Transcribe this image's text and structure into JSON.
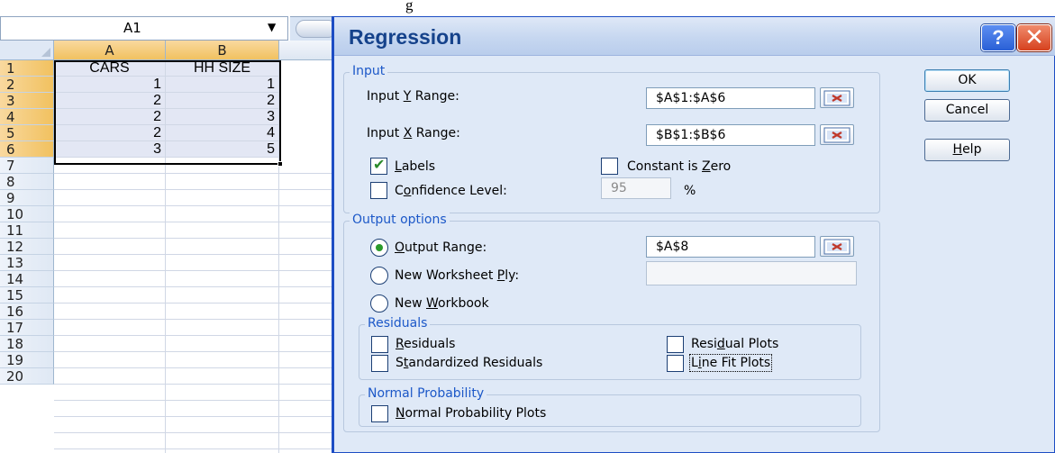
{
  "caption": "Regression dialog",
  "name_box": {
    "value": "A1"
  },
  "sheet": {
    "columns": [
      "A",
      "B"
    ],
    "rows": [
      "1",
      "2",
      "3",
      "4",
      "5",
      "6",
      "7",
      "8",
      "9",
      "10",
      "11",
      "12",
      "13",
      "14",
      "15",
      "16",
      "17",
      "18",
      "19",
      "20"
    ],
    "header_row": [
      "CARS",
      "HH SIZE"
    ],
    "data": [
      [
        "1",
        "1"
      ],
      [
        "2",
        "2"
      ],
      [
        "2",
        "3"
      ],
      [
        "2",
        "4"
      ],
      [
        "3",
        "5"
      ]
    ]
  },
  "dialog": {
    "title": "Regression",
    "help_glyph": "?",
    "close_glyph": "✕",
    "input": {
      "legend": "Input",
      "y_label": "Input Y Range:",
      "y_value": "$A$1:$A$6",
      "x_label": "Input X Range:",
      "x_value": "$B$1:$B$6",
      "labels_label": "Labels",
      "labels_checked": true,
      "constant_zero_label": "Constant is Zero",
      "confidence_label": "Confidence Level:",
      "confidence_value": "95",
      "percent": "%"
    },
    "output": {
      "legend": "Output options",
      "output_range_label": "Output Range:",
      "output_range_value": "$A$8",
      "new_ply_label": "New Worksheet Ply:",
      "new_workbook_label": "New Workbook",
      "selected": "output_range"
    },
    "residuals": {
      "legend": "Residuals",
      "residuals_label": "Residuals",
      "standardized_label": "Standardized Residuals",
      "residual_plots_label": "Residual Plots",
      "line_fit_label": "Line Fit Plots"
    },
    "normal": {
      "legend": "Normal Probability",
      "plots_label": "Normal Probability Plots"
    },
    "buttons": {
      "ok": "OK",
      "cancel": "Cancel",
      "help": "Help"
    }
  },
  "colors": {
    "title_text": "#15428b",
    "legend_text": "#1c58c8",
    "dialog_bg": "#dfe9f7",
    "selected_header": "#f1c15f"
  },
  "icons": {
    "range_picker": "range-picker-icon",
    "dropdown": "chevron-down-icon"
  }
}
